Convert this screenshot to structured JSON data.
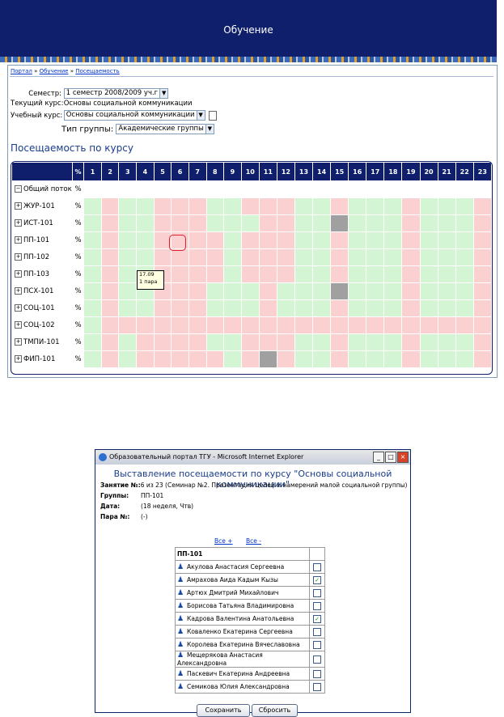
{
  "header": {
    "title": "Обучение"
  },
  "breadcrumb": {
    "items": [
      "Портал",
      "Обучение",
      "Посещаемость"
    ],
    "sep": "»"
  },
  "form": {
    "semester_label": "Семестр:",
    "semester_value": "1 семестр 2008/2009 уч.г",
    "current_course_label": "Текущий курс:",
    "current_course_value": "Основы социальной коммуникации",
    "study_course_label": "Учебный курс:",
    "study_course_value": "Основы социальной коммуникации",
    "group_type_label": "Тип группы:",
    "group_type_value": "Академические группы"
  },
  "section_title": "Посещаемость по курсу",
  "grid": {
    "pct_header": "%",
    "days": [
      "1",
      "2",
      "3",
      "4",
      "5",
      "6",
      "7",
      "8",
      "9",
      "10",
      "11",
      "12",
      "13",
      "14",
      "15",
      "16",
      "17",
      "18",
      "19",
      "20",
      "21",
      "22",
      "23"
    ],
    "groups": [
      {
        "name": "Общий поток",
        "pct": "%",
        "toggle": "−",
        "cells": "wwwwwwwwwwwwwwwwwwwwwww"
      },
      {
        "name": "ЖУР-101",
        "pct": "%",
        "toggle": "+",
        "cells": "grggrrrggrrrggrgggrgggr"
      },
      {
        "name": "ИСТ-101",
        "pct": "%",
        "toggle": "+",
        "cells": "grggrrrgggrrggxgggrgggr"
      },
      {
        "name": "ПП-101",
        "pct": "%",
        "toggle": "+",
        "cells": "grggrrrrgrrrggrgggrgggr"
      },
      {
        "name": "ПП-102",
        "pct": "%",
        "toggle": "+",
        "cells": "grggrrrrgrrrggrgggrgggr"
      },
      {
        "name": "ПП-103",
        "pct": "%",
        "toggle": "+",
        "cells": "grggrrrrgrrrggrgggrgggr"
      },
      {
        "name": "ПСХ-101",
        "pct": "%",
        "toggle": "+",
        "cells": "grggrrrgggrgggxgggrgggr"
      },
      {
        "name": "СОЦ-101",
        "pct": "%",
        "toggle": "+",
        "cells": "grggrrrgggrgggrgggrgggr"
      },
      {
        "name": "СОЦ-102",
        "pct": "%",
        "toggle": "+",
        "cells": "grrrrrrrrrrrrrrrrrrrrrr"
      },
      {
        "name": "ТМПИ-101",
        "pct": "%",
        "toggle": "+",
        "cells": "grgrrrrggrrrggrgggrgggr"
      },
      {
        "name": "ФИП-101",
        "pct": "%",
        "toggle": "+",
        "cells": "grgrrrrrgrxrggrgggrgggr"
      }
    ],
    "tooltip_line1": "17.09",
    "tooltip_line2": "1 пара"
  },
  "dialog": {
    "window_title": "Образовательный портал ТГУ - Microsoft Internet Explorer",
    "heading": "Выставление посещаемости по курсу \"Основы социальной коммуникации\"",
    "lesson_label": "Занятие №:",
    "lesson_value": "6 из 23 (Семинар №2. Презентация целей и намерений малой социальной группы)",
    "groups_label": "Группы:",
    "groups_value": "ПП-101",
    "date_label": "Дата:",
    "date_value": "(18 неделя, Чтв)",
    "pair_label": "Пара №:",
    "pair_value": "(-)",
    "all_plus": "Все +",
    "all_minus": "Все -",
    "group_header": "ПП-101",
    "students": [
      {
        "name": "Акулова Анастасия Сергеевна",
        "checked": false
      },
      {
        "name": "Амрахова Аида Кадым Кызы",
        "checked": true
      },
      {
        "name": "Артюх Дмитрий Михайлович",
        "checked": false
      },
      {
        "name": "Борисова Татьяна Владимировна",
        "checked": false
      },
      {
        "name": "Кадрова Валентина Анатольевна",
        "checked": true
      },
      {
        "name": "Коваленко Екатерина Сергеевна",
        "checked": false
      },
      {
        "name": "Королева Екатерина Вячеславовна",
        "checked": false
      },
      {
        "name": "Мещерякова Анастасия Александровна",
        "checked": false
      },
      {
        "name": "Паскевич Екатерина Андреевна",
        "checked": false
      },
      {
        "name": "Семикова Юлия Александровна",
        "checked": false
      }
    ],
    "save_label": "Сохранить",
    "reset_label": "Сбросить"
  },
  "colors": {
    "banner": "#0f1f6b",
    "present": "#d4f5d4",
    "absent": "#fbd0d0",
    "no_class": "#a0a0a0"
  }
}
